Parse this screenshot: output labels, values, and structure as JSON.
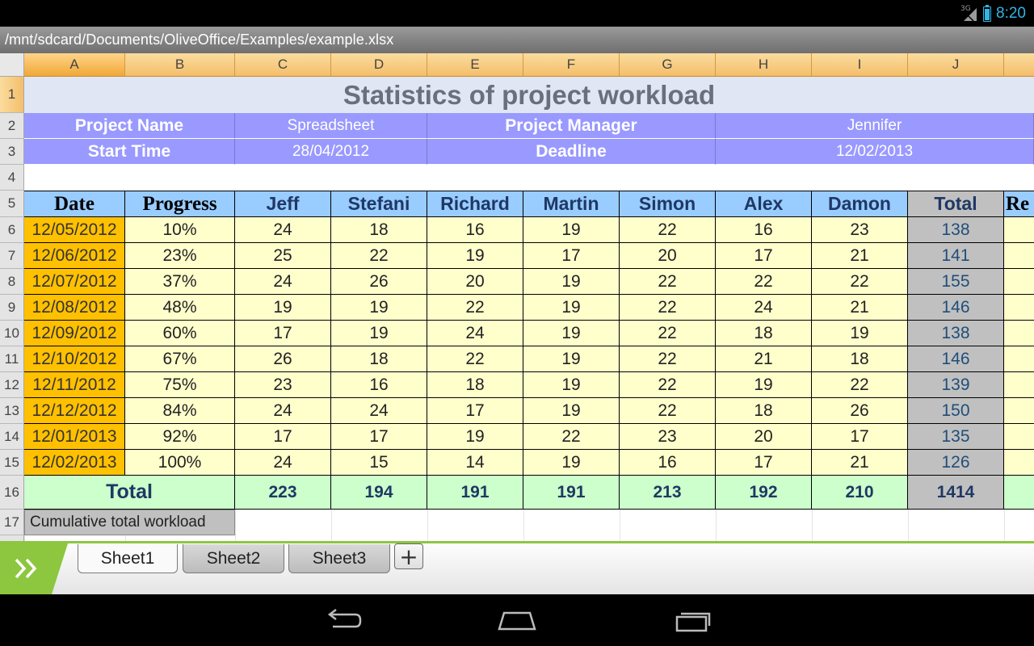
{
  "status_bar": {
    "network_label": "3G",
    "time": "8:20",
    "battery_icon": "battery-charging-icon",
    "signal_icon": "signal-icon"
  },
  "file_path": "/mnt/sdcard/Documents/OliveOffice/Examples/example.xlsx",
  "columns": [
    "A",
    "B",
    "C",
    "D",
    "E",
    "F",
    "G",
    "H",
    "I",
    "J"
  ],
  "selected_cell": "A1",
  "rows": [
    "1",
    "2",
    "3",
    "4",
    "5",
    "6",
    "7",
    "8",
    "9",
    "10",
    "11",
    "12",
    "13",
    "14",
    "15",
    "16",
    "17"
  ],
  "sheet": {
    "title": "Statistics of project workload",
    "info": {
      "project_name_label": "Project Name",
      "project_name": "Spreadsheet",
      "project_manager_label": "Project Manager",
      "project_manager": "Jennifer",
      "start_time_label": "Start Time",
      "start_time": "28/04/2012",
      "deadline_label": "Deadline",
      "deadline": "12/02/2013"
    },
    "headers": [
      "Date",
      "Progress",
      "Jeff",
      "Stefani",
      "Richard",
      "Martin",
      "Simon",
      "Alex",
      "Damon",
      "Total",
      "Re"
    ],
    "data": [
      [
        "12/05/2012",
        "10%",
        "24",
        "18",
        "16",
        "19",
        "22",
        "16",
        "23",
        "138"
      ],
      [
        "12/06/2012",
        "23%",
        "25",
        "22",
        "19",
        "17",
        "20",
        "17",
        "21",
        "141"
      ],
      [
        "12/07/2012",
        "37%",
        "24",
        "26",
        "20",
        "19",
        "22",
        "22",
        "22",
        "155"
      ],
      [
        "12/08/2012",
        "48%",
        "19",
        "19",
        "22",
        "19",
        "22",
        "24",
        "21",
        "146"
      ],
      [
        "12/09/2012",
        "60%",
        "17",
        "19",
        "24",
        "19",
        "22",
        "18",
        "19",
        "138"
      ],
      [
        "12/10/2012",
        "67%",
        "26",
        "18",
        "22",
        "19",
        "22",
        "21",
        "18",
        "146"
      ],
      [
        "12/11/2012",
        "75%",
        "23",
        "16",
        "18",
        "19",
        "22",
        "19",
        "22",
        "139"
      ],
      [
        "12/12/2012",
        "84%",
        "24",
        "24",
        "17",
        "19",
        "22",
        "18",
        "26",
        "150"
      ],
      [
        "12/01/2013",
        "92%",
        "17",
        "17",
        "19",
        "22",
        "23",
        "20",
        "17",
        "135"
      ],
      [
        "12/02/2013",
        "100%",
        "24",
        "15",
        "14",
        "19",
        "16",
        "17",
        "21",
        "126"
      ]
    ],
    "totals_label": "Total",
    "totals": [
      "223",
      "194",
      "191",
      "191",
      "213",
      "192",
      "210",
      "1414"
    ],
    "cumulative_label": "Cumulative total workload"
  },
  "sheet_tabs": [
    "Sheet1",
    "Sheet2",
    "Sheet3"
  ],
  "active_sheet": "Sheet1",
  "add_sheet_label": "+",
  "colors": {
    "accent_green": "#8dc63f",
    "status_blue": "#33b5e5",
    "date_fill": "#ffc000",
    "value_fill": "#ffffcc",
    "header_fill": "#99ccff",
    "info_fill": "#9999ff"
  }
}
